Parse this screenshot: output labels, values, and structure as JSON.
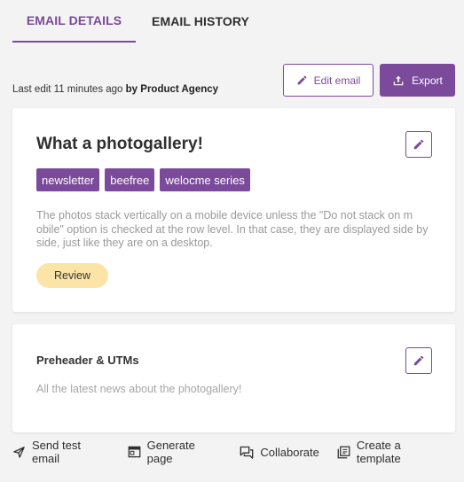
{
  "tabs": [
    {
      "label": "EMAIL DETAILS",
      "active": true
    },
    {
      "label": "EMAIL HISTORY",
      "active": false
    }
  ],
  "last_edit": {
    "prefix": "Last edit 11 minutes ago",
    "by": "by Product Agency"
  },
  "actions": {
    "edit_label": "Edit email",
    "export_label": "Export"
  },
  "email": {
    "title": "What a photogallery!",
    "tags": [
      "newsletter",
      "beefree",
      "welocme series"
    ],
    "description": "The photos stack vertically on a mobile device unless the \"Do not stack on m obile\" option is checked at the row level. In that case, they are displayed side by side, just like they are on a desktop.",
    "status": "Review"
  },
  "preheader": {
    "title": "Preheader & UTMs",
    "text": "All the latest news about the photogallery!"
  },
  "footer": {
    "send_test": "Send test email",
    "generate_page": "Generate page",
    "collaborate": "Collaborate",
    "create_template": "Create a template"
  },
  "colors": {
    "accent": "#7b4a9b",
    "badge_bg": "#fbe4a6",
    "page_bg": "#f3f3f4"
  }
}
